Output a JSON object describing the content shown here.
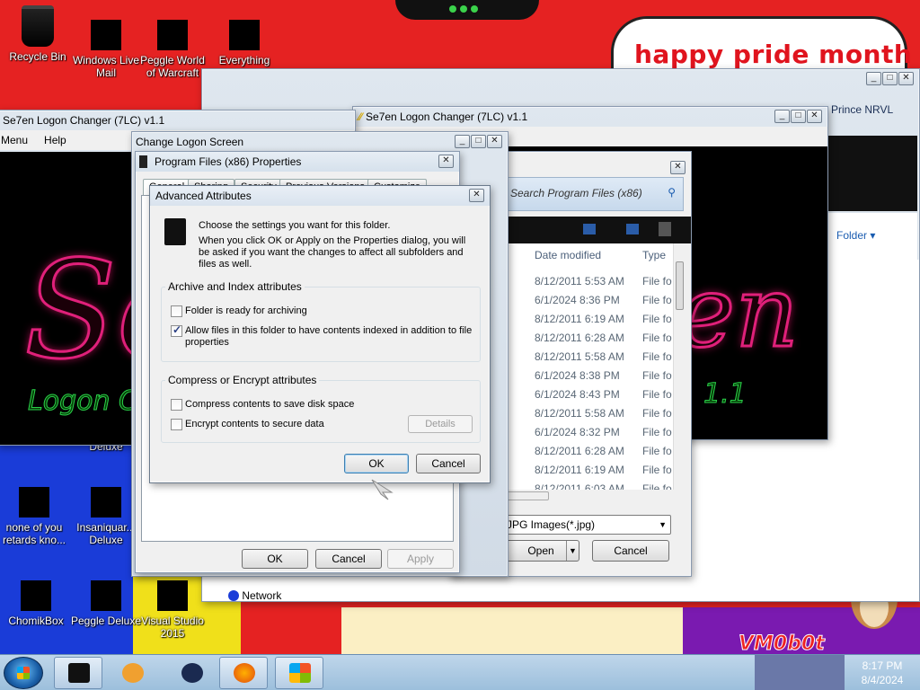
{
  "desktop": {
    "banner": "happy pride month",
    "watermark": "VM0b0t",
    "icons": [
      {
        "label": "Recycle Bin"
      },
      {
        "label": "Windows Live Mail"
      },
      {
        "label": "Peggle World of Warcraft"
      },
      {
        "label": "Everything"
      },
      {
        "label": "Deluxe"
      },
      {
        "label": "none of you retards kno..."
      },
      {
        "label": "Insaniquar... Deluxe"
      },
      {
        "label": "ChomikBox"
      },
      {
        "label": "Peggle Deluxe"
      },
      {
        "label": "Visual Studio 2015"
      }
    ],
    "colors": {
      "red": "#e52222",
      "blue": "#1a3cd8",
      "yellow": "#f0e01a",
      "purple": "#7a1ab0"
    }
  },
  "back_window": {
    "partial_title": "Prince NRVL",
    "folder_label": "Folder ▾"
  },
  "se7en_left": {
    "title": "Se7en Logon Changer (7LC) v1.1",
    "menu": [
      "Menu",
      "Help"
    ],
    "bg_text": "Se",
    "bg_sub": "Logon C"
  },
  "se7en_right": {
    "title": "Se7en Logon Changer (7LC) v1.1",
    "bg_text": "en",
    "bg_version": "1.1"
  },
  "change_logon": {
    "title": "Change Logon Screen"
  },
  "open_dialog": {
    "search_placeholder": "Search Program Files (x86)",
    "columns": [
      "Date modified",
      "Type"
    ],
    "rows": [
      {
        "date": "8/12/2011 5:53 AM",
        "type": "File fo"
      },
      {
        "date": "6/1/2024 8:36 PM",
        "type": "File fo"
      },
      {
        "date": "8/12/2011 6:19 AM",
        "type": "File fo"
      },
      {
        "date": "8/12/2011 6:28 AM",
        "type": "File fo"
      },
      {
        "date": "8/12/2011 5:58 AM",
        "type": "File fo"
      },
      {
        "date": "6/1/2024 8:38 PM",
        "type": "File fo"
      },
      {
        "date": "6/1/2024 8:43 PM",
        "type": "File fo"
      },
      {
        "date": "8/12/2011 5:58 AM",
        "type": "File fo"
      },
      {
        "date": "6/1/2024 8:32 PM",
        "type": "File fo"
      },
      {
        "date": "8/12/2011 6:28 AM",
        "type": "File fo"
      },
      {
        "date": "8/12/2011 6:19 AM",
        "type": "File fo"
      },
      {
        "date": "8/12/2011 6:03 AM",
        "type": "File fo"
      }
    ],
    "filter": "JPG Images(*.jpg)",
    "open_label": "Open",
    "cancel_label": "Cancel",
    "nav_item": "Network"
  },
  "properties": {
    "title": "Program Files (x86) Properties",
    "tabs": [
      "General",
      "Sharing",
      "Security",
      "Previous Versions",
      "Customize"
    ],
    "ok_label": "OK",
    "cancel_label": "Cancel",
    "apply_label": "Apply"
  },
  "advanced": {
    "title": "Advanced Attributes",
    "intro_line1": "Choose the settings you want for this folder.",
    "intro_line2": "When you click OK or Apply on the Properties dialog, you will be asked if you want the changes to affect all subfolders and files as well.",
    "archive_group": "Archive and Index attributes",
    "archive_option": "Folder is ready for archiving",
    "archive_checked": false,
    "index_option": "Allow files in this folder to have contents indexed in addition to file properties",
    "index_checked": true,
    "compress_group": "Compress or Encrypt attributes",
    "compress_option": "Compress contents to save disk space",
    "compress_checked": false,
    "encrypt_option": "Encrypt contents to secure data",
    "encrypt_checked": false,
    "details_label": "Details",
    "ok_label": "OK",
    "cancel_label": "Cancel"
  },
  "taskbar": {
    "time": "8:17 PM",
    "date": "8/4/2024"
  }
}
